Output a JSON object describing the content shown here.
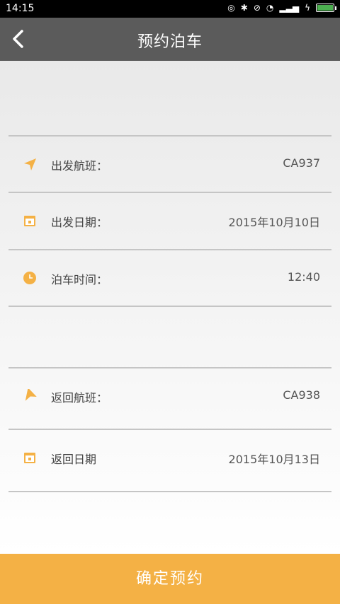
{
  "status_bar": {
    "time": "14:15"
  },
  "app_bar": {
    "title": "预约泊车"
  },
  "rows": [
    {
      "label": "出发航班：",
      "value": "CA937",
      "icon": "send-icon"
    },
    {
      "label": "出发日期：",
      "value": "2015年10月10日",
      "icon": "calendar-icon"
    },
    {
      "label": "泊车时间：",
      "value": "12:40",
      "icon": "clock-icon"
    },
    {
      "label": "返回航班：",
      "value": "CA938",
      "icon": "return-flight-icon"
    },
    {
      "label": "返回日期",
      "value": "2015年10月13日",
      "icon": "calendar-icon"
    }
  ],
  "actions": {
    "confirm_label": "确定预约"
  },
  "colors": {
    "accent": "#f4b145",
    "app_bar": "#5b5b5b"
  }
}
